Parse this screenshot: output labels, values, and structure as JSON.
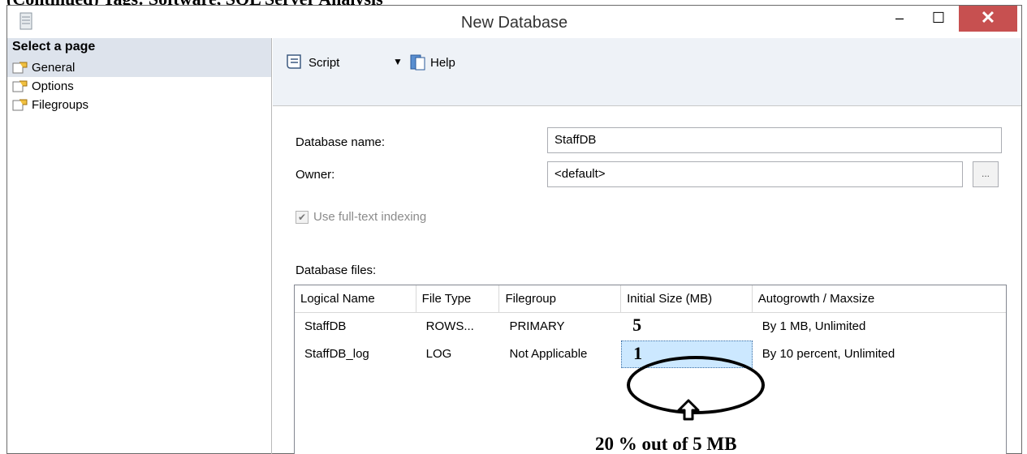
{
  "top_caption": "(Continued) Tags: Software, SQL Server Analysis",
  "window": {
    "title": "New Database",
    "minimize": "–",
    "maximize": "☐",
    "close": "✕"
  },
  "sidebar": {
    "header": "Select a page",
    "items": [
      {
        "label": "General"
      },
      {
        "label": "Options"
      },
      {
        "label": "Filegroups"
      }
    ]
  },
  "toolbar": {
    "script_label": "Script",
    "dropdown_glyph": "▼",
    "help_label": "Help"
  },
  "form": {
    "db_name_label": "Database name:",
    "db_name_value": "StaffDB",
    "owner_label": "Owner:",
    "owner_value": "<default>",
    "browse_label": "...",
    "fulltext_label": "Use full-text indexing",
    "files_label": "Database files:"
  },
  "grid": {
    "columns": [
      "Logical Name",
      "File Type",
      "Filegroup",
      "Initial Size (MB)",
      "Autogrowth / Maxsize"
    ],
    "rows": [
      {
        "name": "StaffDB",
        "type": "ROWS...",
        "group": "PRIMARY",
        "size": "5",
        "growth": "By 1 MB, Unlimited"
      },
      {
        "name": "StaffDB_log",
        "type": "LOG",
        "group": "Not Applicable",
        "size": "1",
        "growth": "By 10 percent, Unlimited"
      }
    ]
  },
  "annotation": {
    "note": "20 % out of 5 MB"
  },
  "colors": {
    "close_bg": "#c75050",
    "sidebar_selected": "#dde3ec",
    "toolbar_bg": "#eef2f7",
    "cell_selected": "#cce8ff"
  }
}
